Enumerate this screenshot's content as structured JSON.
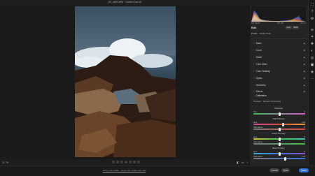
{
  "window": {
    "title": "_DK_4485.ARW  ·  Camera Raw 15"
  },
  "canvas": {
    "zoom": "21.7%"
  },
  "file_info": "Sony ILCE-7RM4 · 24mm f/11 1/160s ISO 100",
  "buttons": {
    "cancel": "Cancel",
    "open": "Open",
    "done": "Done"
  },
  "histogram": {
    "left": "f/11  1/160s",
    "mid": "ISO 100",
    "right": "24 mm"
  },
  "edit": {
    "title": "Edit",
    "auto_label": "Auto",
    "bw_label": "B&W",
    "profile_label": "Profile",
    "profile_value": "Adobe Color",
    "sections": [
      "Basic",
      "Curve",
      "Detail",
      "Color Mixer",
      "Color Grading",
      "Optics",
      "Geometry",
      "Effects"
    ],
    "calibration": {
      "title": "Calibration",
      "process_label": "Process",
      "process_value": "Version 6 (Current)",
      "shadows": {
        "title": "Shadows",
        "tint_label": "Tint",
        "tint_value": "0",
        "tint_level": 0.5
      },
      "red": {
        "title": "Red Primary",
        "hue_label": "Hue",
        "hue_value": "+16",
        "hue_level": 0.58,
        "sat_label": "Saturation",
        "sat_value": "0",
        "sat_level": 0.5
      },
      "green": {
        "title": "Green Primary",
        "hue_label": "Hue",
        "hue_value": "0",
        "hue_level": 0.5,
        "sat_label": "Saturation",
        "sat_value": "0",
        "sat_level": 0.5
      },
      "blue": {
        "title": "Blue Primary",
        "hue_label": "Hue",
        "hue_value": "0",
        "hue_level": 0.5,
        "sat_label": "Saturation",
        "sat_value": "+23",
        "sat_level": 0.62
      }
    }
  },
  "colors": {
    "accent": "#2f6fd8",
    "panel": "#242424",
    "background": "#1d1d1d"
  },
  "toolbar_icons": [
    "edit-icon",
    "crop-icon",
    "heal-icon",
    "mask-icon",
    "redeye-icon",
    "snapshot-icon",
    "presets-icon",
    "more-icon",
    "settings-icon"
  ]
}
